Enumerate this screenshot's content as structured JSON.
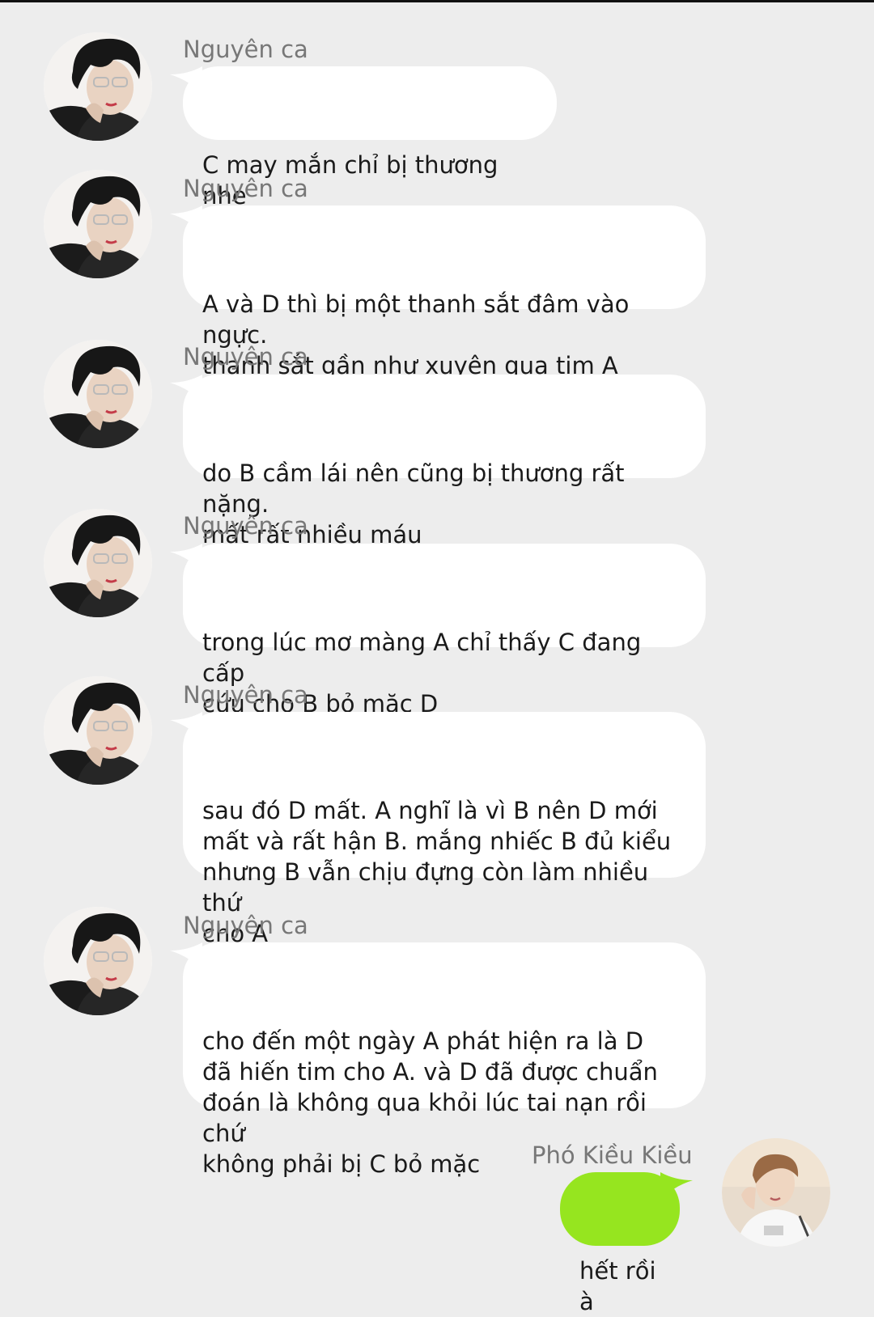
{
  "colors": {
    "background": "#ededed",
    "incoming_bubble": "#ffffff",
    "outgoing_bubble": "#96e51f",
    "sender_name": "#777777"
  },
  "messages": [
    {
      "sender": "Nguyên ca",
      "text": "C may mắn chỉ bị thương nhẹ",
      "side": "left",
      "avatar": "avatar-male-glasses"
    },
    {
      "sender": "Nguyên ca",
      "text": "A và D thì bị một thanh sắt đâm vào ngực.\nthanh sắt gần như xuyên qua tim A",
      "side": "left",
      "avatar": "avatar-male-glasses"
    },
    {
      "sender": "Nguyên ca",
      "text": "do B cầm lái nên cũng bị thương rất nặng.\nmất rất nhiều máu",
      "side": "left",
      "avatar": "avatar-male-glasses"
    },
    {
      "sender": "Nguyên ca",
      "text": "trong lúc mơ màng A chỉ thấy C đang cấp\ncứu cho B bỏ mặc D",
      "side": "left",
      "avatar": "avatar-male-glasses"
    },
    {
      "sender": "Nguyên ca",
      "text": "sau đó D mất. A nghĩ là vì B nên D mới\nmất và rất hận B. mắng nhiếc B đủ kiểu\nnhưng B vẫn chịu đựng còn làm nhiều thứ\ncho A",
      "side": "left",
      "avatar": "avatar-male-glasses"
    },
    {
      "sender": "Nguyên ca",
      "text": "cho đến một ngày A phát hiện ra là D\nđã hiến tim cho A. và D đã được chuẩn\nđoán là không qua khỏi lúc tai nạn rồi chứ\nkhông phải bị C bỏ mặc",
      "side": "left",
      "avatar": "avatar-male-glasses"
    },
    {
      "sender": "Phó Kiều Kiều",
      "text": "hết rồi à",
      "side": "right",
      "avatar": "avatar-male-light"
    }
  ]
}
